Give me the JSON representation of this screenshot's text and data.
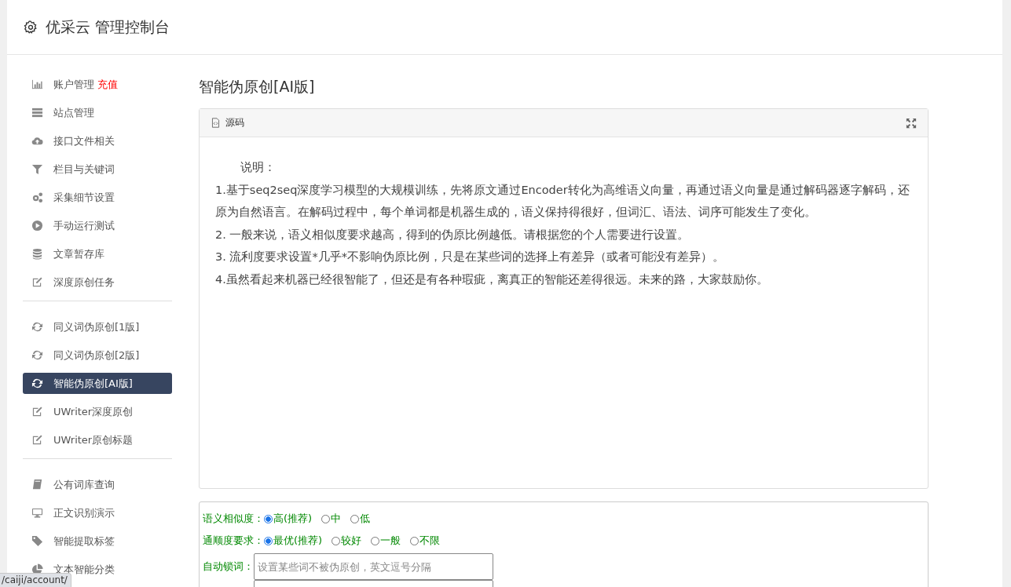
{
  "header": {
    "title": "优采云 管理控制台"
  },
  "sidebar": {
    "groups": [
      {
        "items": [
          {
            "label": "账户管理",
            "badge": "充值",
            "selected": false
          },
          {
            "label": "站点管理",
            "selected": false
          },
          {
            "label": "接口文件相关",
            "selected": false
          },
          {
            "label": "栏目与关键词",
            "selected": false
          },
          {
            "label": "采集细节设置",
            "selected": false
          },
          {
            "label": "手动运行测试",
            "selected": false
          },
          {
            "label": "文章暂存库",
            "selected": false
          },
          {
            "label": "深度原创任务",
            "selected": false
          }
        ]
      },
      {
        "items": [
          {
            "label": "同义词伪原创[1版]",
            "selected": false
          },
          {
            "label": "同义词伪原创[2版]",
            "selected": false
          },
          {
            "label": "智能伪原创[AI版]",
            "selected": true
          },
          {
            "label": "UWriter深度原创",
            "selected": false
          },
          {
            "label": "UWriter原创标题",
            "selected": false
          }
        ]
      },
      {
        "items": [
          {
            "label": "公有词库查询",
            "selected": false
          },
          {
            "label": "正文识别演示",
            "selected": false
          },
          {
            "label": "智能提取标签",
            "selected": false
          },
          {
            "label": "文本智能分类",
            "selected": false
          }
        ]
      }
    ]
  },
  "page_title": "智能伪原创[AI版]",
  "editor": {
    "tab": "源码",
    "lines": [
      "说明：",
      "1.基于seq2seq深度学习模型的大规模训练，先将原文通过Encoder转化为高维语义向量，再通过语义向量是通过解码器逐字解码，还原为自然语言。在解码过程中，每个单词都是机器生成的，语义保持得很好，但词汇、语法、词序可能发生了变化。",
      "2. 一般来说，语义相似度要求越高，得到的伪原比例越低。请根据您的个人需要进行设置。",
      "3. 流利度要求设置*几乎*不影响伪原比例，只是在某些词的选择上有差异（或者可能没有差异）。",
      "4.虽然看起来机器已经很智能了，但还是有各种瑕疵，离真正的智能还差得很远。未来的路，大家鼓励你。"
    ]
  },
  "settings": {
    "radio_groups": [
      {
        "label": "语义相似度：",
        "options": [
          {
            "label": "高(推荐)",
            "selected": true
          },
          {
            "label": "中",
            "selected": false
          },
          {
            "label": "低",
            "selected": false
          }
        ]
      },
      {
        "label": "通顺度要求：",
        "options": [
          {
            "label": "最优(推荐)",
            "selected": true
          },
          {
            "label": "较好",
            "selected": false
          },
          {
            "label": "一般",
            "selected": false
          },
          {
            "label": "不限",
            "selected": false
          }
        ]
      }
    ],
    "lock_words": {
      "label": "自动锁词：",
      "placeholder": "设置某些词不被伪原创，英文逗号分隔"
    }
  },
  "status_url": "/caiji/account/"
}
